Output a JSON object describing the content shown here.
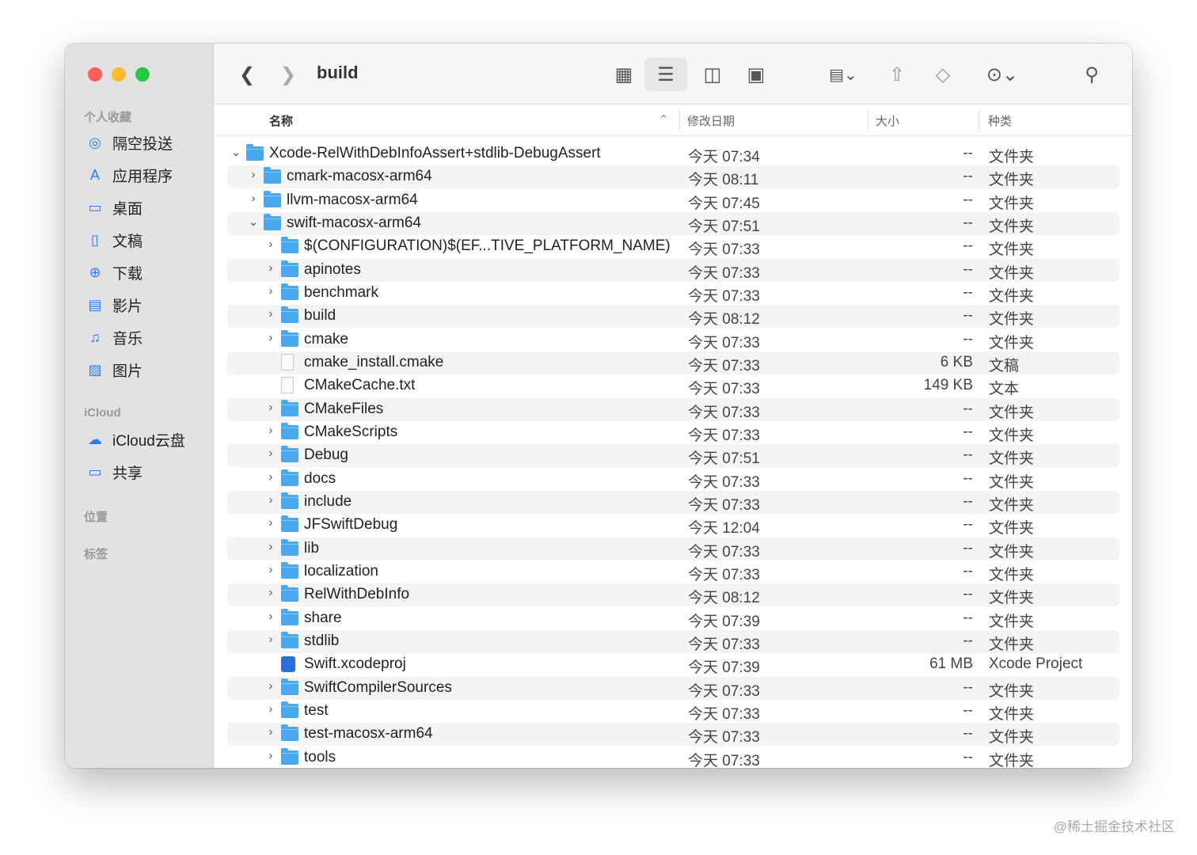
{
  "window": {
    "title": "build"
  },
  "sidebar": {
    "sections": [
      {
        "label": "个人收藏"
      },
      {
        "label": "iCloud"
      },
      {
        "label": "位置"
      },
      {
        "label": "标签"
      }
    ],
    "favorites": [
      {
        "label": "隔空投送",
        "icon": "airdrop-icon"
      },
      {
        "label": "应用程序",
        "icon": "applications-icon"
      },
      {
        "label": "桌面",
        "icon": "desktop-icon"
      },
      {
        "label": "文稿",
        "icon": "document-icon"
      },
      {
        "label": "下载",
        "icon": "download-icon"
      },
      {
        "label": "影片",
        "icon": "film-icon"
      },
      {
        "label": "音乐",
        "icon": "music-icon"
      },
      {
        "label": "图片",
        "icon": "photo-icon"
      }
    ],
    "icloud": [
      {
        "label": "iCloud云盘",
        "icon": "cloud-icon"
      },
      {
        "label": "共享",
        "icon": "shared-folder-icon"
      }
    ]
  },
  "columns": {
    "name": "名称",
    "date": "修改日期",
    "size": "大小",
    "kind": "种类"
  },
  "rows": [
    {
      "level": 0,
      "expand": "open",
      "type": "folder",
      "name": "Xcode-RelWithDebInfoAssert+stdlib-DebugAssert",
      "date": "今天 07:34",
      "size": "--",
      "kind": "文件夹"
    },
    {
      "level": 1,
      "expand": "closed",
      "type": "folder",
      "name": "cmark-macosx-arm64",
      "date": "今天 08:11",
      "size": "--",
      "kind": "文件夹"
    },
    {
      "level": 1,
      "expand": "closed",
      "type": "folder",
      "name": "llvm-macosx-arm64",
      "date": "今天 07:45",
      "size": "--",
      "kind": "文件夹"
    },
    {
      "level": 1,
      "expand": "open",
      "type": "folder",
      "name": "swift-macosx-arm64",
      "date": "今天 07:51",
      "size": "--",
      "kind": "文件夹"
    },
    {
      "level": 2,
      "expand": "closed",
      "type": "folder",
      "name": "$(CONFIGURATION)$(EF...TIVE_PLATFORM_NAME)",
      "date": "今天 07:33",
      "size": "--",
      "kind": "文件夹"
    },
    {
      "level": 2,
      "expand": "closed",
      "type": "folder",
      "name": "apinotes",
      "date": "今天 07:33",
      "size": "--",
      "kind": "文件夹"
    },
    {
      "level": 2,
      "expand": "closed",
      "type": "folder",
      "name": "benchmark",
      "date": "今天 07:33",
      "size": "--",
      "kind": "文件夹"
    },
    {
      "level": 2,
      "expand": "closed",
      "type": "folder",
      "name": "build",
      "date": "今天 08:12",
      "size": "--",
      "kind": "文件夹"
    },
    {
      "level": 2,
      "expand": "closed",
      "type": "folder",
      "name": "cmake",
      "date": "今天 07:33",
      "size": "--",
      "kind": "文件夹"
    },
    {
      "level": 2,
      "expand": "none",
      "type": "doc",
      "name": "cmake_install.cmake",
      "date": "今天 07:33",
      "size": "6 KB",
      "kind": "文稿"
    },
    {
      "level": 2,
      "expand": "none",
      "type": "doc",
      "name": "CMakeCache.txt",
      "date": "今天 07:33",
      "size": "149 KB",
      "kind": "文本"
    },
    {
      "level": 2,
      "expand": "closed",
      "type": "folder",
      "name": "CMakeFiles",
      "date": "今天 07:33",
      "size": "--",
      "kind": "文件夹"
    },
    {
      "level": 2,
      "expand": "closed",
      "type": "folder",
      "name": "CMakeScripts",
      "date": "今天 07:33",
      "size": "--",
      "kind": "文件夹"
    },
    {
      "level": 2,
      "expand": "closed",
      "type": "folder",
      "name": "Debug",
      "date": "今天 07:51",
      "size": "--",
      "kind": "文件夹"
    },
    {
      "level": 2,
      "expand": "closed",
      "type": "folder",
      "name": "docs",
      "date": "今天 07:33",
      "size": "--",
      "kind": "文件夹"
    },
    {
      "level": 2,
      "expand": "closed",
      "type": "folder",
      "name": "include",
      "date": "今天 07:33",
      "size": "--",
      "kind": "文件夹"
    },
    {
      "level": 2,
      "expand": "closed",
      "type": "folder",
      "name": "JFSwiftDebug",
      "date": "今天 12:04",
      "size": "--",
      "kind": "文件夹"
    },
    {
      "level": 2,
      "expand": "closed",
      "type": "folder",
      "name": "lib",
      "date": "今天 07:33",
      "size": "--",
      "kind": "文件夹"
    },
    {
      "level": 2,
      "expand": "closed",
      "type": "folder",
      "name": "localization",
      "date": "今天 07:33",
      "size": "--",
      "kind": "文件夹"
    },
    {
      "level": 2,
      "expand": "closed",
      "type": "folder",
      "name": "RelWithDebInfo",
      "date": "今天 08:12",
      "size": "--",
      "kind": "文件夹"
    },
    {
      "level": 2,
      "expand": "closed",
      "type": "folder",
      "name": "share",
      "date": "今天 07:39",
      "size": "--",
      "kind": "文件夹"
    },
    {
      "level": 2,
      "expand": "closed",
      "type": "folder",
      "name": "stdlib",
      "date": "今天 07:33",
      "size": "--",
      "kind": "文件夹"
    },
    {
      "level": 2,
      "expand": "none",
      "type": "xcode",
      "name": "Swift.xcodeproj",
      "date": "今天 07:39",
      "size": "61 MB",
      "kind": "Xcode Project"
    },
    {
      "level": 2,
      "expand": "closed",
      "type": "folder",
      "name": "SwiftCompilerSources",
      "date": "今天 07:33",
      "size": "--",
      "kind": "文件夹"
    },
    {
      "level": 2,
      "expand": "closed",
      "type": "folder",
      "name": "test",
      "date": "今天 07:33",
      "size": "--",
      "kind": "文件夹"
    },
    {
      "level": 2,
      "expand": "closed",
      "type": "folder",
      "name": "test-macosx-arm64",
      "date": "今天 07:33",
      "size": "--",
      "kind": "文件夹"
    },
    {
      "level": 2,
      "expand": "closed",
      "type": "folder",
      "name": "tools",
      "date": "今天 07:33",
      "size": "--",
      "kind": "文件夹"
    }
  ],
  "watermark": "@稀土掘金技术社区"
}
